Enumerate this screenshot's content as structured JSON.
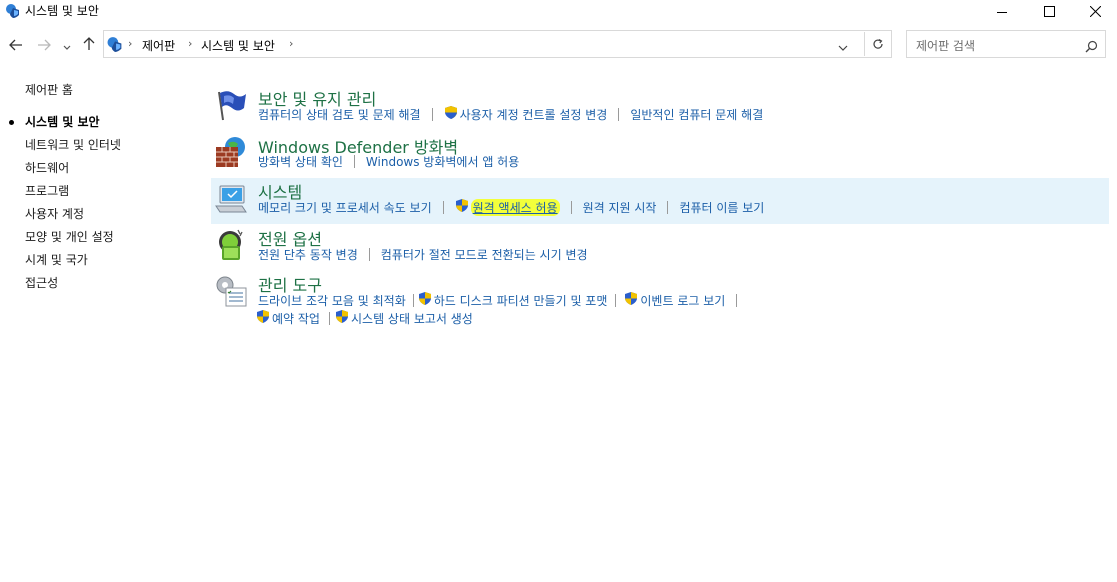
{
  "window": {
    "title": "시스템 및 보안",
    "minimize_icon": "minimize-icon",
    "maximize_icon": "maximize-icon",
    "close_icon": "close-icon"
  },
  "nav": {
    "back_icon": "back-arrow-icon",
    "forward_icon": "forward-arrow-icon",
    "recent_icon": "chevron-down-icon",
    "up_icon": "up-arrow-icon"
  },
  "address": {
    "crumbs": [
      "제어판",
      "시스템 및 보안"
    ],
    "separator": "›"
  },
  "search": {
    "placeholder": "제어판 검색"
  },
  "sidebar": {
    "items": [
      {
        "label": "제어판 홈",
        "current": false
      },
      {
        "label": "시스템 및 보안",
        "current": true
      },
      {
        "label": "네트워크 및 인터넷",
        "current": false
      },
      {
        "label": "하드웨어",
        "current": false
      },
      {
        "label": "프로그램",
        "current": false
      },
      {
        "label": "사용자 계정",
        "current": false
      },
      {
        "label": "모양 및 개인 설정",
        "current": false
      },
      {
        "label": "시계 및 국가",
        "current": false
      },
      {
        "label": "접근성",
        "current": false
      }
    ]
  },
  "categories": {
    "security": {
      "title": "보안 및 유지 관리",
      "links": [
        "컴퓨터의 상태 검토 및 문제 해결",
        "사용자 계정 컨트롤 설정 변경",
        "일반적인 컴퓨터 문제 해결"
      ]
    },
    "firewall": {
      "title": "Windows Defender 방화벽",
      "links": [
        "방화벽 상태 확인",
        "Windows 방화벽에서 앱 허용"
      ]
    },
    "system": {
      "title": "시스템",
      "links": [
        "메모리 크기 및 프로세서 속도 보기",
        "원격 액세스 허용",
        "원격 지원 시작",
        "컴퓨터 이름 보기"
      ]
    },
    "power": {
      "title": "전원 옵션",
      "links": [
        "전원 단추 동작 변경",
        "컴퓨터가 절전 모드로 전환되는 시기 변경"
      ]
    },
    "admin": {
      "title": "관리 도구",
      "links": [
        "드라이브 조각 모음 및 최적화",
        "하드 디스크 파티션 만들기 및 포맷",
        "이벤트 로그 보기",
        "예약 작업",
        "시스템 상태 보고서 생성"
      ]
    }
  },
  "colors": {
    "link": "#1c5fa8",
    "category_title": "#1e7145",
    "hover_bg": "#e5f3fb",
    "highlight": "#f3ff3a"
  }
}
